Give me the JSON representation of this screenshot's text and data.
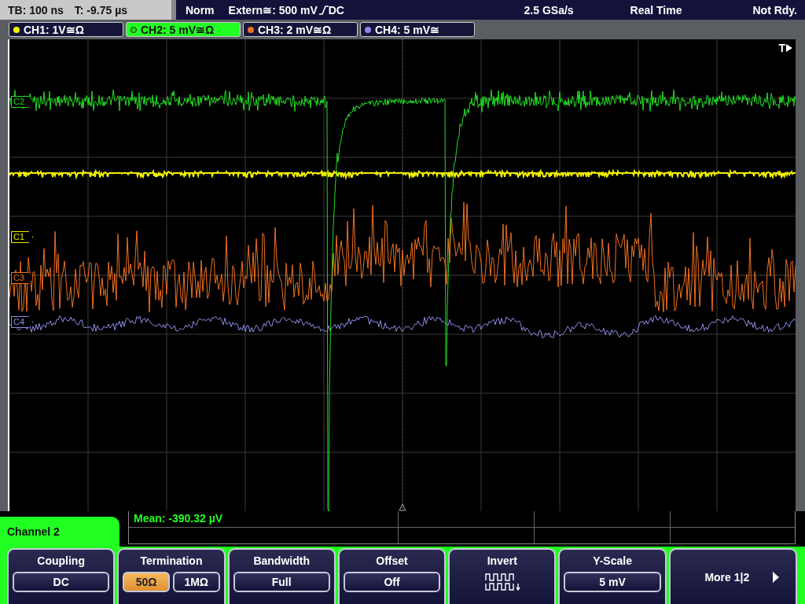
{
  "status_bar": {
    "timebase": "TB: 100 ns",
    "trigger_time": "T: -9.75 µs",
    "mode": "Norm",
    "trigger_source": "Extern≅: 500 mV",
    "trigger_coupling": "DC",
    "sample_rate": "2.5 GSa/s",
    "acquisition": "Real Time",
    "state": "Not Rdy."
  },
  "channels": [
    {
      "label": "CH1: 1V≅Ω",
      "color": "#f0f000",
      "selected": false
    },
    {
      "label": "CH2: 5 mV≅Ω",
      "color": "#22dd22",
      "selected": true
    },
    {
      "label": "CH3: 2 mV≅Ω",
      "color": "#f07020",
      "selected": false
    },
    {
      "label": "CH4: 5 mV≅",
      "color": "#8c8ce6",
      "selected": false
    }
  ],
  "trigger_marker": "T",
  "markers": [
    {
      "label": "C2",
      "color": "#22dd22"
    },
    {
      "label": "C1",
      "color": "#f0f000"
    },
    {
      "label": "C3",
      "color": "#f07020"
    },
    {
      "label": "C4",
      "color": "#8c8ce6"
    }
  ],
  "menu_title": "Channel 2",
  "measurement": "Mean: -390.32 µV",
  "softkeys": [
    {
      "kind": "value",
      "label": "Coupling",
      "value": "DC"
    },
    {
      "kind": "toggle",
      "label": "Termination",
      "options": [
        {
          "label": "50Ω",
          "selected": true
        },
        {
          "label": "1MΩ",
          "selected": false
        }
      ]
    },
    {
      "kind": "value",
      "label": "Bandwidth",
      "value": "Full"
    },
    {
      "kind": "value",
      "label": "Offset",
      "value": "Off"
    },
    {
      "kind": "icon",
      "label": "Invert"
    },
    {
      "kind": "value",
      "label": "Y-Scale",
      "value": "5 mV"
    },
    {
      "kind": "more",
      "label": "More 1|2"
    }
  ]
}
